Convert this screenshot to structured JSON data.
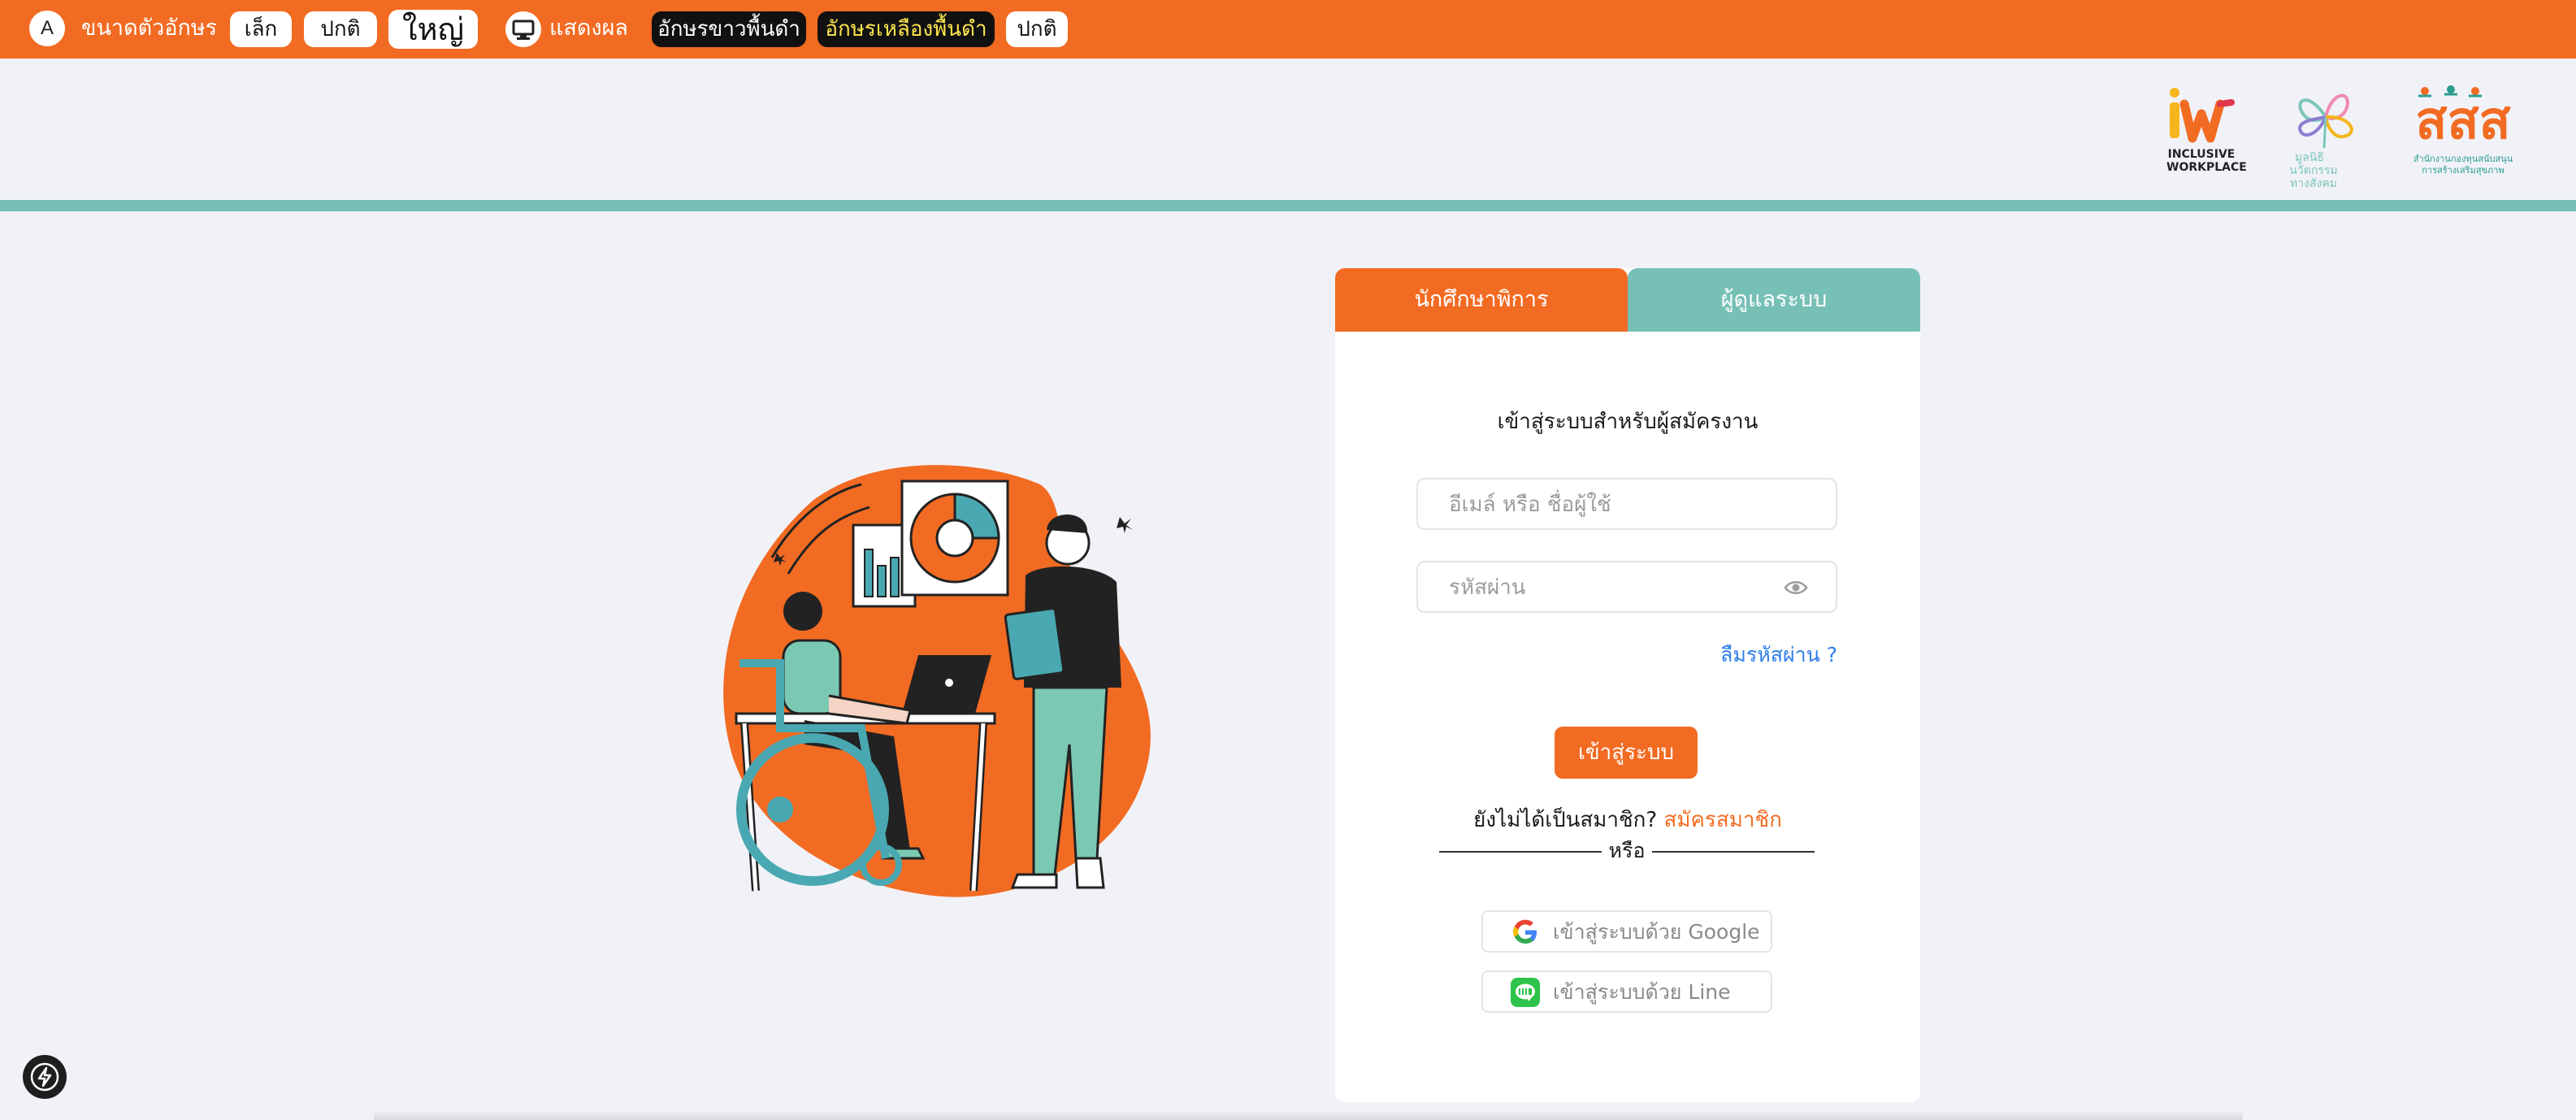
{
  "toolbar": {
    "font_icon_letter": "A",
    "font_size_label": "ขนาดตัวอักษร",
    "small_label": "เล็ก",
    "normal_label": "ปกติ",
    "large_label": "ใหญ่",
    "display_label": "แสดงผล",
    "white_on_black_label": "อักษรขาวพื้นดำ",
    "yellow_on_black_label": "อักษรเหลืองพื้นดำ",
    "display_normal_label": "ปกติ",
    "colors": {
      "bar": "#f26b22",
      "yellow_text": "#ffe64d"
    }
  },
  "header": {
    "logos": [
      {
        "name": "iw-logo",
        "mark": "iw",
        "caption_line1": "INCLUSIVE",
        "caption_line2": "WORKPLACE"
      },
      {
        "name": "foundation-logo",
        "caption_line1": "มูลนิธิ",
        "caption_line2": "นวัตกรรม",
        "caption_line3": "ทางสังคม"
      },
      {
        "name": "thaihealth-logo",
        "mark": "สสส",
        "caption_line1": "สำนักงานกองทุนสนับสนุน",
        "caption_line2": "การสร้างเสริมสุขภาพ"
      }
    ],
    "accent_strip_color": "#77c0b6"
  },
  "login": {
    "tabs": [
      {
        "label": "นักศึกษาพิการ",
        "active": true
      },
      {
        "label": "ผู้ดูแลระบบ",
        "active": false
      }
    ],
    "title": "เข้าสู่ระบบสำหรับผู้สมัครงาน",
    "email_placeholder": "อีเมล์ หรือ ชื่อผู้ใช้",
    "email_value": "",
    "password_placeholder": "รหัสผ่าน",
    "password_value": "",
    "forgot_label": "ลืมรหัสผ่าน ?",
    "submit_label": "เข้าสู่ระบบ",
    "no_account_label": "ยังไม่ได้เป็นสมาชิก?",
    "register_label": "สมัครสมาชิก",
    "or_label": "หรือ",
    "google_label": "เข้าสู่ระบบด้วย Google",
    "line_label": "เข้าสู่ระบบด้วย Line",
    "colors": {
      "primary": "#f26b22",
      "secondary": "#77c0b6",
      "link": "#2d7ee8"
    }
  },
  "illustration": {
    "name": "wheelchair-user-working-with-colleague"
  },
  "floating": {
    "icon": "bolt-icon"
  }
}
